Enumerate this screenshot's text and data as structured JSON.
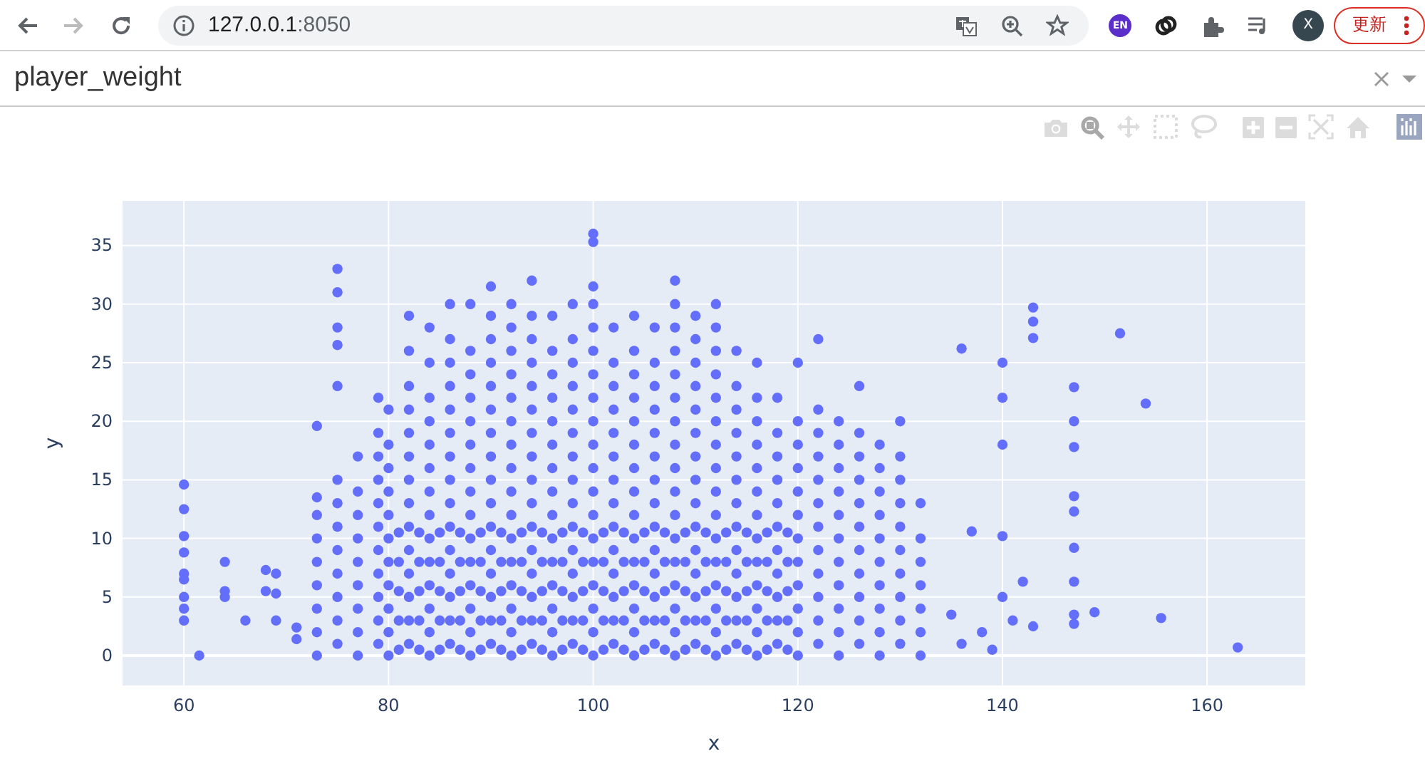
{
  "browser": {
    "back_disabled": false,
    "forward_disabled": true,
    "url": {
      "host": "127.0.0.1",
      "port": ":8050"
    },
    "extension_badge": "EN",
    "profile_initial": "X",
    "update_button": "更新"
  },
  "dropdown": {
    "value": "player_weight",
    "clearable": true
  },
  "modebar_buttons": [
    {
      "selected": false
    },
    {
      "selected": true
    },
    {
      "selected": false
    },
    {
      "selected": false
    },
    {
      "selected": false
    },
    {
      "selected": false
    },
    {
      "selected": false
    },
    {
      "selected": false
    },
    {
      "selected": false
    }
  ],
  "chart": {
    "chart_data": {
      "type": "scatter",
      "grid": true,
      "xlabel": "x",
      "ylabel": "y",
      "xlim": [
        54,
        169.6
      ],
      "ylim": [
        -2.55,
        38.8
      ],
      "xticks": [
        60,
        80,
        100,
        120,
        140,
        160
      ],
      "yticks": [
        0,
        5,
        10,
        15,
        20,
        25,
        30,
        35
      ],
      "x": [
        60,
        60,
        60,
        60,
        60,
        60,
        60,
        60,
        60,
        61.5,
        64,
        64,
        64,
        66,
        68,
        68,
        69,
        69,
        69,
        71,
        71,
        73,
        135,
        136,
        136,
        137,
        138,
        139,
        140,
        140,
        140,
        140,
        140,
        141,
        142,
        143,
        143,
        143,
        143,
        147,
        147,
        147,
        147,
        147,
        147,
        147,
        147,
        147,
        149,
        151.5,
        154,
        155.5,
        163,
        73,
        73,
        73,
        73,
        73,
        73,
        73,
        73,
        75,
        75,
        75,
        75,
        75,
        75,
        75,
        75,
        75,
        75,
        75,
        75,
        75,
        77,
        77,
        77,
        77,
        77,
        77,
        77,
        77,
        77,
        79,
        79,
        79,
        79,
        79,
        79,
        79,
        79,
        79,
        79,
        79,
        80,
        80,
        80,
        80,
        80,
        80,
        80,
        80,
        80,
        80,
        80,
        82,
        82,
        82,
        82,
        82,
        82,
        82,
        82,
        82,
        82,
        82,
        82,
        82,
        82,
        84,
        84,
        84,
        84,
        84,
        84,
        84,
        84,
        84,
        84,
        84,
        84,
        84,
        84,
        86,
        86,
        86,
        86,
        86,
        86,
        86,
        86,
        86,
        86,
        86,
        86,
        86,
        86,
        86,
        88,
        88,
        88,
        88,
        88,
        88,
        88,
        88,
        88,
        88,
        88,
        88,
        88,
        88,
        88,
        90,
        90,
        90,
        90,
        90,
        90,
        90,
        90,
        90,
        90,
        90,
        90,
        90,
        90,
        90,
        90,
        92,
        92,
        92,
        92,
        92,
        92,
        92,
        92,
        92,
        92,
        92,
        92,
        92,
        92,
        92,
        92,
        94,
        94,
        94,
        94,
        94,
        94,
        94,
        94,
        94,
        94,
        94,
        94,
        94,
        94,
        94,
        94,
        96,
        96,
        96,
        96,
        96,
        96,
        96,
        96,
        96,
        96,
        96,
        96,
        96,
        96,
        96,
        98,
        98,
        98,
        98,
        98,
        98,
        98,
        98,
        98,
        98,
        98,
        98,
        98,
        98,
        98,
        100,
        100,
        100,
        100,
        100,
        100,
        100,
        100,
        100,
        100,
        100,
        100,
        100,
        100,
        100,
        100,
        100,
        100,
        100,
        102,
        102,
        102,
        102,
        102,
        102,
        102,
        102,
        102,
        102,
        102,
        102,
        102,
        102,
        104,
        104,
        104,
        104,
        104,
        104,
        104,
        104,
        104,
        104,
        104,
        104,
        104,
        104,
        104,
        106,
        106,
        106,
        106,
        106,
        106,
        106,
        106,
        106,
        106,
        106,
        106,
        106,
        106,
        108,
        108,
        108,
        108,
        108,
        108,
        108,
        108,
        108,
        108,
        108,
        108,
        108,
        108,
        108,
        108,
        108,
        110,
        110,
        110,
        110,
        110,
        110,
        110,
        110,
        110,
        110,
        110,
        110,
        110,
        110,
        110,
        112,
        112,
        112,
        112,
        112,
        112,
        112,
        112,
        112,
        112,
        112,
        112,
        112,
        112,
        112,
        112,
        114,
        114,
        114,
        114,
        114,
        114,
        114,
        114,
        114,
        114,
        114,
        114,
        114,
        116,
        116,
        116,
        116,
        116,
        116,
        116,
        116,
        116,
        116,
        116,
        116,
        116,
        118,
        118,
        118,
        118,
        118,
        118,
        118,
        118,
        118,
        118,
        118,
        120,
        120,
        120,
        120,
        120,
        120,
        120,
        120,
        120,
        120,
        120,
        120,
        122,
        122,
        122,
        122,
        122,
        122,
        122,
        122,
        122,
        122,
        122,
        122,
        124,
        124,
        124,
        124,
        124,
        124,
        124,
        124,
        124,
        124,
        124,
        126,
        126,
        126,
        126,
        126,
        126,
        126,
        126,
        126,
        126,
        126,
        128,
        128,
        128,
        128,
        128,
        128,
        128,
        128,
        128,
        128,
        130,
        130,
        130,
        130,
        130,
        130,
        130,
        130,
        130,
        130,
        132,
        132,
        132,
        132,
        132,
        132,
        132,
        81,
        81,
        81,
        81,
        81,
        83,
        83,
        83,
        83,
        83,
        85,
        85,
        85,
        85,
        85,
        87,
        87,
        87,
        87,
        87,
        89,
        89,
        89,
        89,
        89,
        91,
        91,
        91,
        91,
        91,
        93,
        93,
        93,
        93,
        93,
        95,
        95,
        95,
        95,
        95,
        97,
        97,
        97,
        97,
        97,
        99,
        99,
        99,
        99,
        99,
        101,
        101,
        101,
        101,
        101,
        103,
        103,
        103,
        103,
        103,
        105,
        105,
        105,
        105,
        105,
        107,
        107,
        107,
        107,
        107,
        109,
        109,
        109,
        109,
        109,
        111,
        111,
        111,
        111,
        111,
        113,
        113,
        113,
        113,
        113,
        115,
        115,
        115,
        115,
        115,
        117,
        117,
        117,
        117,
        117,
        119,
        119,
        119,
        119,
        119
      ],
      "series": [
        {
          "color": "#636efa",
          "values": [
            14.6,
            12.5,
            10.2,
            8.8,
            7,
            6.5,
            5,
            4,
            3,
            0,
            8,
            5.5,
            5,
            3,
            7.3,
            5.5,
            7,
            5.3,
            3,
            2.4,
            1.4,
            19.6,
            3.5,
            26.2,
            1,
            10.6,
            2,
            0.5,
            25,
            22,
            18,
            10.2,
            5,
            3,
            6.3,
            29.7,
            28.5,
            27.1,
            2.5,
            22.9,
            20,
            17.8,
            13.6,
            12.3,
            9.2,
            6.3,
            3.5,
            2.7,
            3.7,
            27.5,
            21.5,
            3.2,
            0.7,
            0,
            2,
            4,
            6,
            8,
            10,
            12,
            13.5,
            1,
            3,
            5,
            7,
            9,
            11,
            13,
            15,
            23,
            26.5,
            28,
            31,
            33,
            0,
            2,
            4,
            6,
            8,
            10,
            12,
            14,
            17,
            1,
            3,
            5,
            7,
            9,
            11,
            13,
            15,
            17,
            19,
            22,
            0,
            2,
            4,
            6,
            8,
            10,
            12,
            14,
            16,
            18,
            21,
            1,
            3,
            5,
            7,
            9,
            11,
            13,
            15,
            17,
            19,
            21,
            23,
            26,
            29,
            0,
            2,
            4,
            6,
            8,
            10,
            12,
            14,
            16,
            18,
            20,
            22,
            25,
            28,
            1,
            3,
            5,
            7,
            9,
            11,
            13,
            15,
            17,
            19,
            21,
            23,
            25,
            27,
            30,
            0,
            2,
            4,
            6,
            8,
            10,
            12,
            14,
            16,
            18,
            20,
            22,
            24,
            26,
            30,
            1,
            3,
            5,
            7,
            9,
            11,
            13,
            15,
            17,
            19,
            21,
            23,
            25,
            27,
            29,
            31.5,
            0,
            2,
            4,
            6,
            8,
            10,
            12,
            14,
            16,
            18,
            20,
            22,
            24,
            26,
            28,
            30,
            1,
            3,
            5,
            7,
            9,
            11,
            13,
            15,
            17,
            19,
            21,
            23,
            25,
            27,
            29,
            32,
            0,
            2,
            4,
            6,
            8,
            10,
            12,
            14,
            16,
            18,
            20,
            22,
            24,
            26,
            29,
            1,
            3,
            5,
            7,
            9,
            11,
            13,
            15,
            17,
            19,
            21,
            23,
            25,
            27,
            30,
            0,
            2,
            4,
            6,
            8,
            10,
            12,
            14,
            16,
            18,
            20,
            22,
            24,
            26,
            28,
            30,
            31.5,
            35.3,
            36,
            1,
            3,
            5,
            7,
            9,
            11,
            13,
            15,
            17,
            19,
            21,
            23,
            25,
            28,
            0,
            2,
            4,
            6,
            8,
            10,
            12,
            14,
            16,
            18,
            20,
            22,
            24,
            26,
            29,
            1,
            3,
            5,
            7,
            9,
            11,
            13,
            15,
            17,
            19,
            21,
            23,
            25,
            28,
            0,
            2,
            4,
            6,
            8,
            10,
            12,
            14,
            16,
            18,
            20,
            22,
            24,
            26,
            28,
            30,
            32,
            1,
            3,
            5,
            7,
            9,
            11,
            13,
            15,
            17,
            19,
            21,
            23,
            25,
            27,
            29,
            0,
            2,
            4,
            6,
            8,
            10,
            12,
            14,
            16,
            18,
            20,
            22,
            24,
            26,
            28,
            30,
            1,
            3,
            5,
            7,
            9,
            11,
            13,
            15,
            17,
            19,
            21,
            23,
            26,
            0,
            2,
            4,
            6,
            8,
            10,
            12,
            14,
            16,
            18,
            20,
            22,
            25,
            1,
            3,
            5,
            7,
            9,
            11,
            13,
            15,
            17,
            19,
            22,
            0,
            2,
            4,
            6,
            8,
            10,
            12,
            14,
            16,
            18,
            20,
            25,
            1,
            3,
            5,
            7,
            9,
            11,
            13,
            15,
            17,
            19,
            21,
            27,
            0,
            2,
            4,
            6,
            8,
            10,
            12,
            14,
            16,
            18,
            20,
            1,
            3,
            5,
            7,
            9,
            11,
            13,
            15,
            17,
            19,
            23,
            0,
            2,
            4,
            6,
            8,
            10,
            12,
            14,
            16,
            18,
            1,
            3,
            5,
            7,
            9,
            11,
            13,
            15,
            17,
            20,
            0,
            2,
            4,
            6,
            8,
            10,
            13,
            0.5,
            3,
            5.5,
            8,
            10.5,
            0.5,
            3,
            5.5,
            8,
            10.5,
            0.5,
            3,
            5.5,
            8,
            10.5,
            0.5,
            3,
            5.5,
            8,
            10.5,
            0.5,
            3,
            5.5,
            8,
            10.5,
            0.5,
            3,
            5.5,
            8,
            10.5,
            0.5,
            3,
            5.5,
            8,
            10.5,
            0.5,
            3,
            5.5,
            8,
            10.5,
            0.5,
            3,
            5.5,
            8,
            10.5,
            0.5,
            3,
            5.5,
            8,
            10.5,
            0.5,
            3,
            5.5,
            8,
            10.5,
            0.5,
            3,
            5.5,
            8,
            10.5,
            0.5,
            3,
            5.5,
            8,
            10.5,
            0.5,
            3,
            5.5,
            8,
            10.5,
            0.5,
            3,
            5.5,
            8,
            10.5,
            0.5,
            3,
            5.5,
            8,
            10.5,
            0.5,
            3,
            5.5,
            8,
            10.5,
            0.5,
            3,
            5.5,
            8,
            10.5,
            0.5,
            3,
            5.5,
            8,
            10.5,
            0.5,
            3,
            5.5,
            8,
            10.5
          ]
        }
      ]
    }
  }
}
